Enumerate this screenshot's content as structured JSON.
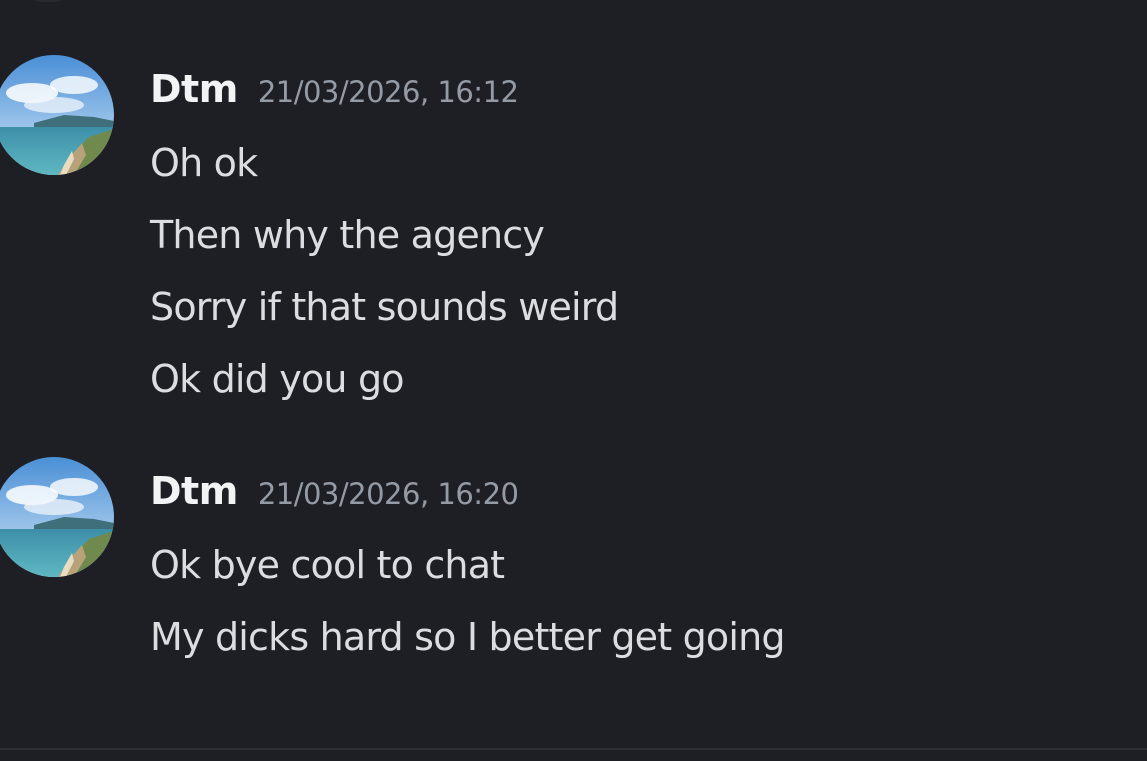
{
  "messages": [
    {
      "author": "Dtm",
      "timestamp": "21/03/2026, 16:12",
      "avatar_icon": "landscape-avatar-icon",
      "lines": [
        "Oh ok",
        "Then why the agency",
        "Sorry if that sounds weird",
        "Ok did you go"
      ]
    },
    {
      "author": "Dtm",
      "timestamp": "21/03/2026, 16:20",
      "avatar_icon": "landscape-avatar-icon",
      "lines": [
        "Ok bye cool to chat",
        "My dicks hard so I better get going"
      ]
    }
  ],
  "colors": {
    "background": "#1e1f24",
    "username": "#f2f3f5",
    "timestamp": "#949ba4",
    "message_text": "#dbdee1"
  }
}
